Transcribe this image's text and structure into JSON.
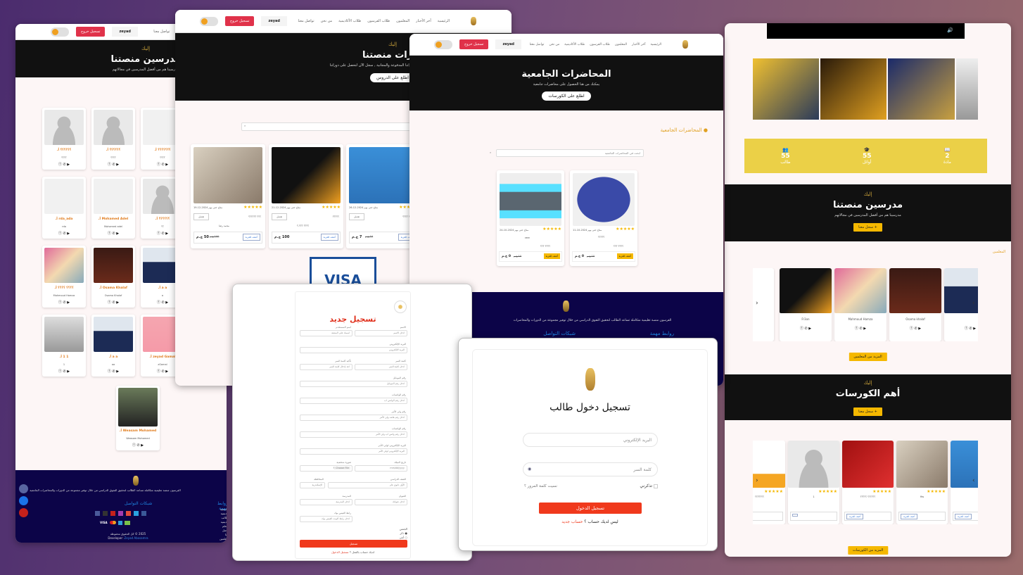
{
  "nav": {
    "links": [
      "الرئيسية",
      "آخر الأخبار",
      "المعلمون",
      "طلاب الفرسون",
      "طلاب الأكاديمية",
      "من نحن",
      "تواصل معنا"
    ],
    "user": "zeyad",
    "register": "تسجيل خروج"
  },
  "teachers_page": {
    "kicker": "إليك",
    "title": "مدرسين منصتنا",
    "subtitle": "مدرسينا هم من أفضل المدرسين في مجالاتهم",
    "cards": [
      {
        "name": "؟؟؟؟؟؟؟ أ.",
        "sub": "؟؟؟؟",
        "photo": "blank"
      },
      {
        "name": "؟؟؟؟؟؟ أ.",
        "sub": "؟؟؟؟",
        "photo": "avatar"
      },
      {
        "name": "؟؟؟؟؟؟ أ.",
        "sub": "؟؟؟؟",
        "photo": "avatar"
      },
      {
        "name": "؟؟؟؟؟؟ أ.",
        "sub": "؟؟",
        "photo": "avatar"
      },
      {
        "name": "Mohamed Adel أ.",
        "sub": "Mohamed adel",
        "photo": "blank"
      },
      {
        "name": "rda_ada أ.",
        "sub": "rda",
        "photo": "blank"
      },
      {
        "name": "a a أ.",
        "sub": "a",
        "photo": "suit"
      },
      {
        "name": "Osama Khalaf أ.",
        "sub": "Osama Khalaf",
        "photo": "dark"
      },
      {
        "name": "؟؟؟؟ ؟؟؟؟ أ.",
        "sub": "Mahmoud Hamza",
        "photo": "party"
      },
      {
        "name": "zeyad Gamal أ.",
        "sub": "zGamal",
        "photo": "pink"
      },
      {
        "name": "a a أ.",
        "sub": "aa",
        "photo": "suit"
      },
      {
        "name": "1 1 أ.",
        "sub": "1",
        "photo": "grey"
      },
      {
        "name": "Weasam Mohamed أ.",
        "sub": "Weasam Mohamed",
        "photo": "vest"
      }
    ],
    "footer": {
      "about": "الفرسون منصة تعليمية متكاملة تساعد الطالب لتحقيق التفوق الدراسي من خلال توفير مجموعة من الدورات والمحاضرات الجامعية",
      "social_title": "شبكات التواصل",
      "links_title": "روابط مهمة",
      "links": [
        "الرئيسية",
        "أكاديمية الطالب",
        "أكاديمية المعلم",
        "تواصل معنا",
        "المعلمين"
      ],
      "copyright": "2025 © كل الحقوق محفوظة",
      "developer_label": "Developer:",
      "developer": "Zeyad Abosamra",
      "payments": [
        "VISA",
        "Mastercard",
        "AmEx",
        "Fawry"
      ]
    }
  },
  "courses_page": {
    "kicker": "إليك",
    "title": "دورات منصتنا",
    "subtitle": "يمكنك من هنا الحصول على دوراتنا المدفوعة والمجانية , سجل الآن لتحصل على دوراتنا",
    "cta": "اطلع على الدروس",
    "cards": [
      {
        "date": "متاح حتى يوم 2024-12-19",
        "title": "؟؟؟ ؟؟؟؟؟؟",
        "tag": "تعديل",
        "teacher": "محمد رضا",
        "price": "50 ج.م",
        "old_price": "100 ج.م",
        "btn": "أضف للعربة",
        "img": "white"
      },
      {
        "date": "متاح حتى يوم 2024-12-21",
        "title": "؟؟؟؟؟",
        "tag": "تعديل",
        "teacher": "؟؟؟؟ ؟؟؟.؟",
        "price": "100 ج.م",
        "old_price": "",
        "btn": "أضف للعربة",
        "img": "poster"
      },
      {
        "date": "متاح حتى يوم 2024-12-26",
        "title": "؟؟؟؟؟؟ ؟؟؟؟",
        "tag": "تعديل",
        "teacher": "",
        "price": "7 ج.م",
        "old_price": "10 ج.م",
        "btn": "أضف للعربة",
        "img": "floppy"
      }
    ],
    "payment_logo": "VISA"
  },
  "lectures_page": {
    "title": "المحاضرات الجامعية",
    "subtitle": "يمكنك من هنا الحصول على محاضرات جامعية",
    "cta": "اطلع على الكورسات",
    "section": "المحاضرات الجامعية",
    "search_placeholder": "ابحث في المحاضرات الجامعية",
    "cards": [
      {
        "date": "متاح حتى يوم 2024-10-11",
        "title": "؟؟؟؟؟",
        "teacher": "؟؟؟؟ ؟؟؟",
        "price": "0 ج.م",
        "old_price": "10 ج.م",
        "btn": "أضف للعربة",
        "img": "arrow"
      },
      {
        "date": "متاح حتى يوم 2024-10-24",
        "title": "وووو",
        "teacher": "؟؟؟؟ ؟؟؟",
        "price": "0 ج.م",
        "old_price": "10 ج.م",
        "btn": "أضف للعربة",
        "img": "printer"
      }
    ],
    "footer": {
      "about": "الفرسون منصة تعليمية متكاملة تساعد الطالب لتحقيق التفوق الدراسي من خلال توفير مجموعة من الدورات والمحاضرات",
      "links_title": "روابط مهمة",
      "social_title": "شبكات التواصل"
    }
  },
  "register": {
    "title": "تسجيل جديد",
    "fields": [
      {
        "label": "الاسم",
        "placeholder": "ادخل الاسم"
      },
      {
        "label": "اسم المستخدم",
        "placeholder": "اسمك على المنصة"
      },
      {
        "label": "البريد الإلكتروني",
        "placeholder": "البريد الإلكتروني"
      },
      {
        "label": "كلمة السر",
        "placeholder": "ادخل كلمة السر"
      },
      {
        "label": "تأكيد كلمة السر",
        "placeholder": "اعد إدخال كلمة السر"
      },
      {
        "label": "رقم الموبايل",
        "placeholder": "ادخل رقم الموبايل"
      },
      {
        "label": "رقم الواتساب",
        "placeholder": "ادخل رقم الواتس اب"
      },
      {
        "label": "رقم ولي الأمر",
        "placeholder": "ادخل رقم هاتف ولي الأمر"
      },
      {
        "label": "رقم الواتساب",
        "placeholder": "ادخل رقم واتس اب ولي الأمر"
      },
      {
        "label": "البريد الإلكتروني لولي الأمر",
        "placeholder": "البريد الإلكتروني لولي الأمر"
      },
      {
        "label": "تاريخ الميلاد",
        "placeholder": "mm/dd/yyyy"
      },
      {
        "label": "صورة شخصية",
        "placeholder": "No file chosen"
      },
      {
        "label": "الصف الدراسي",
        "placeholder": "الأول ثانوي عام"
      },
      {
        "label": "المحافظة",
        "placeholder": "الإسكندرية"
      },
      {
        "label": "العنوان",
        "placeholder": "ادخل عنوانك"
      },
      {
        "label": "المدرسة",
        "placeholder": "ادخل المدرسة"
      },
      {
        "label": "رابط الفيس بوك",
        "placeholder": "ادخل رابط اكونت الفيس بوك"
      }
    ],
    "file_button": "Choose File",
    "gender_label": "الجنس",
    "genders": [
      "ذكر",
      "أنثى"
    ],
    "submit": "تسجيل",
    "have_account": "لديك حساب بالفعل ؟",
    "login_link": "تسجيل الدخول"
  },
  "login": {
    "title": "تسجيل دخول طالب",
    "email_placeholder": "البريد الإلكتروني",
    "password_placeholder": "كلمة السر",
    "remember": "تذكرني",
    "forgot": "نسيت كلمة المرور ؟",
    "submit": "تسجيل الدخول",
    "no_account": "ليس لديك حساب ؟",
    "new_account": "حساب جديد"
  },
  "home": {
    "stats": [
      {
        "icon": "users-icon",
        "value": "55",
        "label": "طالب"
      },
      {
        "icon": "graduation-cap-icon",
        "value": "55",
        "label": "أوائل"
      },
      {
        "icon": "book-icon",
        "value": "2",
        "label": "مادة"
      }
    ],
    "teachers_section": {
      "kicker": "إليك",
      "title": "مدرسين منصتنا",
      "subtitle": "مدرسينا هم من أفضل المدرسين في مجالاتهم",
      "cta": "+ سجل معنا",
      "label": "المعلمين",
      "more": "المزيد من المعلمين"
    },
    "teachers": [
      {
        "name": "Fr3on",
        "img": "poster"
      },
      {
        "name": "Mahmoud Hamza",
        "img": "party"
      },
      {
        "name": "Osama khalaf",
        "img": "dark"
      },
      {
        "name": "",
        "img": "suit"
      }
    ],
    "courses_section": {
      "kicker": "إليك",
      "title": "أهم الكورسات",
      "cta": "+ سجل معنا",
      "more": "المزيد من الكورسات"
    },
    "courses": [
      {
        "title": "؟؟؟؟؟؟؟",
        "img": "visa",
        "btn": ""
      },
      {
        "title": "1",
        "img": "avatar",
        "btn": ""
      },
      {
        "title": "؟؟؟؟؟؟ ؟؟؟؟؟",
        "img": "red",
        "btn": "أضف للعربة"
      },
      {
        "title": "ffw",
        "img": "white",
        "btn": "أضف للعربة"
      },
      {
        "title": "",
        "img": "floppy",
        "btn": "أضف للعربة"
      }
    ]
  },
  "colors": {
    "accent": "#f5b800",
    "danger": "#f0391c",
    "hero": "#111111",
    "footer": "#0c0448",
    "orange_text": "#e07a1a"
  }
}
